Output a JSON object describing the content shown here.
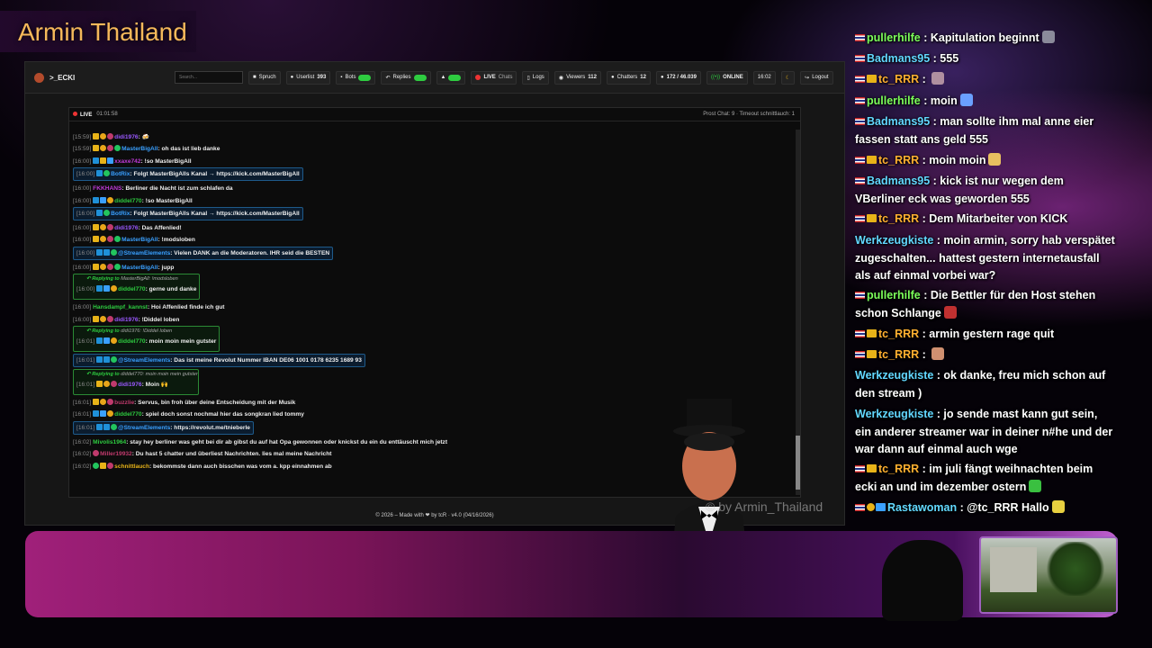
{
  "stream_title": "Armin Thailand",
  "watermark": "© by Armin_Thailand",
  "dashboard": {
    "app_name": ">_ECKI",
    "search_placeholder": "Search...",
    "toolbar": {
      "spruch": "Spruch",
      "userlist": "Userlist",
      "userlist_count": "393",
      "bots": "Bots",
      "replies": "Replies",
      "live": "LIVE",
      "chats": "Chats",
      "logs": "Logs",
      "viewers": "Viewers",
      "viewers_count": "112",
      "chatters": "Chatters",
      "chatters_count": "12",
      "messages": "172 / 46.039",
      "online": "ONLINE",
      "time": "16:02",
      "logout": "Logout"
    },
    "live_label": "LIVE",
    "live_time": "01:01:58",
    "stats": "Prost Chat: 9 · Timeout schnittlauch: 1",
    "footer": "© 2026 – Made with ❤ by tcR · v4.0 (04/16/2026)"
  },
  "messages": [
    {
      "time": "[15:59]",
      "user": "didi1976",
      "color": "#9b59ff",
      "text": "🍻",
      "badges": [
        "b-gold",
        "b-circ",
        "b-pink"
      ]
    },
    {
      "time": "[15:59]",
      "user": "MasterBigAll",
      "color": "#3aa0ff",
      "text": "oh das ist lieb danke",
      "badges": [
        "b-gold",
        "b-circ",
        "b-pink",
        "b-green"
      ]
    },
    {
      "time": "[16:00]",
      "user": "xxaxe742",
      "color": "#c03ad8",
      "text": "!so MasterBigAll",
      "badges": [
        "b-mod",
        "b-gold",
        "b-blue"
      ]
    },
    {
      "time": "[16:00]",
      "user": "BotRix",
      "color": "#3aa0ff",
      "text": "Folgt MasterBigAlls Kanal → https://kick.com/MasterBigAll",
      "badges": [
        "b-mod",
        "b-green"
      ],
      "highlight": true
    },
    {
      "time": "[16:00]",
      "user": "FKKHANS",
      "color": "#c03ad8",
      "text": "Berliner die Nacht ist zum schlafen da",
      "badges": []
    },
    {
      "time": "[16:00]",
      "user": "diddel770",
      "color": "#2ecc40",
      "text": "!so MasterBigAll",
      "badges": [
        "b-mod",
        "b-blue",
        "b-circ"
      ]
    },
    {
      "time": "[16:00]",
      "user": "BotRix",
      "color": "#3aa0ff",
      "text": "Folgt MasterBigAlls Kanal → https://kick.com/MasterBigAll",
      "badges": [
        "b-mod",
        "b-green"
      ],
      "highlight": true
    },
    {
      "time": "[16:00]",
      "user": "didi1976",
      "color": "#9b59ff",
      "text": "Das Affenlied!",
      "badges": [
        "b-gold",
        "b-circ",
        "b-pink"
      ]
    },
    {
      "time": "[16:00]",
      "user": "MasterBigAll",
      "color": "#3aa0ff",
      "text": "!modsloben",
      "badges": [
        "b-gold",
        "b-circ",
        "b-pink",
        "b-green"
      ]
    },
    {
      "time": "[16:00]",
      "user": "@StreamElements",
      "color": "#3aa0ff",
      "text": "Vielen DANK an die Moderatoren. IHR seid die BESTEN",
      "badges": [
        "b-mod",
        "b-mod",
        "b-green"
      ],
      "highlight": true
    },
    {
      "time": "[16:00]",
      "user": "MasterBigAll",
      "color": "#3aa0ff",
      "text": "jupp",
      "badges": [
        "b-gold",
        "b-circ",
        "b-pink",
        "b-green"
      ]
    },
    {
      "time": "[16:00]",
      "user": "diddel770",
      "color": "#2ecc40",
      "text": "gerne und danke",
      "badges": [
        "b-mod",
        "b-blue",
        "b-circ"
      ],
      "reply_to": "MasterBigAll: !modsloben"
    },
    {
      "time": "[16:00]",
      "user": "Hansdampf_kannst",
      "color": "#2ecc40",
      "text": "Hoi Affenlied finde ich gut",
      "badges": []
    },
    {
      "time": "[16:00]",
      "user": "didi1976",
      "color": "#9b59ff",
      "text": "!Diddel loben",
      "badges": [
        "b-gold",
        "b-circ",
        "b-pink"
      ]
    },
    {
      "time": "[16:01]",
      "user": "diddel770",
      "color": "#2ecc40",
      "text": "moin moin mein gutster",
      "badges": [
        "b-mod",
        "b-blue",
        "b-circ"
      ],
      "reply_to": "didi1976: !Diddel loben"
    },
    {
      "time": "[16:01]",
      "user": "@StreamElements",
      "color": "#3aa0ff",
      "text": "Das ist meine Revolut Nummer IBAN DE06 1001 0178 6235 1689 93",
      "badges": [
        "b-mod",
        "b-mod",
        "b-green"
      ],
      "highlight": true
    },
    {
      "time": "[16:01]",
      "user": "didi1976",
      "color": "#9b59ff",
      "text": "Moin 🙌",
      "badges": [
        "b-gold",
        "b-circ",
        "b-pink"
      ],
      "reply_to": "diddel770: moin moin mein gutster"
    },
    {
      "time": "[16:01]",
      "user": "buzzlie",
      "color": "#c03a6d",
      "text": "Servus, bin froh über deine Entscheidung mit der Musik",
      "badges": [
        "b-gold",
        "b-circ",
        "b-pink"
      ]
    },
    {
      "time": "[16:01]",
      "user": "diddel770",
      "color": "#2ecc40",
      "text": "spiel doch sonst nochmal hier das songkran lied tommy",
      "badges": [
        "b-mod",
        "b-blue",
        "b-circ"
      ]
    },
    {
      "time": "[16:01]",
      "user": "@StreamElements",
      "color": "#3aa0ff",
      "text": "https://revolut.me/tnieberle",
      "badges": [
        "b-mod",
        "b-mod",
        "b-green"
      ],
      "highlight": true
    },
    {
      "time": "[16:02]",
      "user": "Mivolis1964",
      "color": "#2ecc40",
      "text": "stay hey berliner was geht bei dir ab gibst du auf hat Opa gewonnen oder knickst du ein du enttäuscht mich jetzt",
      "badges": []
    },
    {
      "time": "[16:02]",
      "user": "Miller19932",
      "color": "#c03a6d",
      "text": "Du hast 5 chatter und überliest Nachrichten. lies mal meine Nachricht",
      "badges": [
        "b-pink"
      ]
    },
    {
      "time": "[16:02]",
      "user": "schnittlauch",
      "color": "#e8b318",
      "text": "bekommste dann auch bisschen was vom a. kpp einnahmen ab",
      "badges": [
        "b-green",
        "b-gold",
        "b-pink"
      ]
    }
  ],
  "right_chat": [
    {
      "user": "pullerhilfe",
      "color": "#7cff5a",
      "text": "Kapitulation beginnt",
      "badges": [
        "flag"
      ],
      "emote": "#8a8a9a"
    },
    {
      "user": "Badmans95",
      "color": "#62d8ff",
      "text": "555",
      "badges": [
        "flag"
      ]
    },
    {
      "user": "tc_RRR",
      "color": "#ffb030",
      "text": "",
      "badges": [
        "flag",
        "crown"
      ],
      "emote": "#b090a0"
    },
    {
      "user": "pullerhilfe",
      "color": "#7cff5a",
      "text": "moin",
      "badges": [
        "flag"
      ],
      "emote": "#6aa0ff"
    },
    {
      "user": "Badmans95",
      "color": "#62d8ff",
      "text": "man sollte ihm mal anne eier fassen statt ans geld 555",
      "badges": [
        "flag"
      ]
    },
    {
      "user": "tc_RRR",
      "color": "#ffb030",
      "text": "moin moin",
      "badges": [
        "flag",
        "crown"
      ],
      "emote": "#e8c060"
    },
    {
      "user": "Badmans95",
      "color": "#62d8ff",
      "text": "kick ist nur wegen dem VBerliner eck was geworden 555",
      "badges": [
        "flag"
      ]
    },
    {
      "user": "tc_RRR",
      "color": "#ffb030",
      "text": "Dem Mitarbeiter von KICK",
      "badges": [
        "flag",
        "crown"
      ]
    },
    {
      "user": "Werkzeugkiste",
      "color": "#62d8ff",
      "text": "moin armin, sorry hab verspätet zugeschalten... hattest gestern internetausfall als auf einmal vorbei war?",
      "badges": []
    },
    {
      "user": "pullerhilfe",
      "color": "#7cff5a",
      "text": "Die Bettler für den Host stehen schon Schlange",
      "badges": [
        "flag"
      ],
      "emote": "#c03030"
    },
    {
      "user": "tc_RRR",
      "color": "#ffb030",
      "text": "armin gestern rage quit",
      "badges": [
        "flag",
        "crown"
      ]
    },
    {
      "user": "tc_RRR",
      "color": "#ffb030",
      "text": "",
      "badges": [
        "flag",
        "crown"
      ],
      "emote": "#d09070"
    },
    {
      "user": "Werkzeugkiste",
      "color": "#62d8ff",
      "text": "ok danke, freu mich schon auf den stream )",
      "badges": []
    },
    {
      "user": "Werkzeugkiste",
      "color": "#62d8ff",
      "text": "jo sende mast kann gut sein, ein anderer streamer war in deiner n#he und der war dann auf einmal auch wge",
      "badges": []
    },
    {
      "user": "tc_RRR",
      "color": "#ffb030",
      "text": "im juli fängt weihnachten beim ecki an und im dezember ostern",
      "badges": [
        "flag",
        "crown"
      ],
      "emote": "#3ac040"
    },
    {
      "user": "Rastawoman",
      "color": "#62d8ff",
      "text": "@tc_RRR Hallo",
      "badges": [
        "flag",
        "coin",
        "mod"
      ],
      "emote": "#e8d040"
    }
  ]
}
